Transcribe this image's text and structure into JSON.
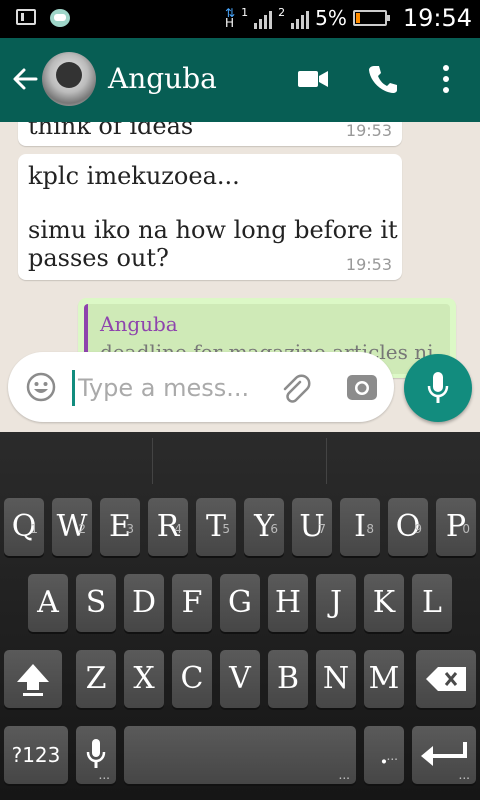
{
  "status_bar": {
    "battery_percent": "5%",
    "time": "19:54",
    "sim1_label": "1",
    "sim2_label": "2",
    "network_label": "H"
  },
  "header": {
    "contact_name": "Anguba"
  },
  "messages": [
    {
      "text": "think of ideas",
      "time": "19:53"
    },
    {
      "line1": "kplc imekuzoea...",
      "line2": "simu iko na how long before it passes out?",
      "time": "19:53"
    }
  ],
  "quoted": {
    "author": "Anguba",
    "text": "deadline for magazine articles ni"
  },
  "input": {
    "placeholder": "Type a mess..."
  },
  "keyboard": {
    "row1": [
      {
        "label": "Q",
        "hint": "1"
      },
      {
        "label": "W",
        "hint": "2"
      },
      {
        "label": "E",
        "hint": "3"
      },
      {
        "label": "R",
        "hint": "4"
      },
      {
        "label": "T",
        "hint": "5"
      },
      {
        "label": "Y",
        "hint": "6"
      },
      {
        "label": "U",
        "hint": "7"
      },
      {
        "label": "I",
        "hint": "8"
      },
      {
        "label": "O",
        "hint": "9"
      },
      {
        "label": "P",
        "hint": "0"
      }
    ],
    "row2": [
      "A",
      "S",
      "D",
      "F",
      "G",
      "H",
      "J",
      "K",
      "L"
    ],
    "row3": [
      "Z",
      "X",
      "C",
      "V",
      "B",
      "N",
      "M"
    ],
    "symbols_label": "?123",
    "period_label": "."
  },
  "colors": {
    "header": "#075e54",
    "accent": "#128c7e",
    "outgoing_bubble": "#dcf8c6",
    "quote_bar": "#8e44ad"
  }
}
